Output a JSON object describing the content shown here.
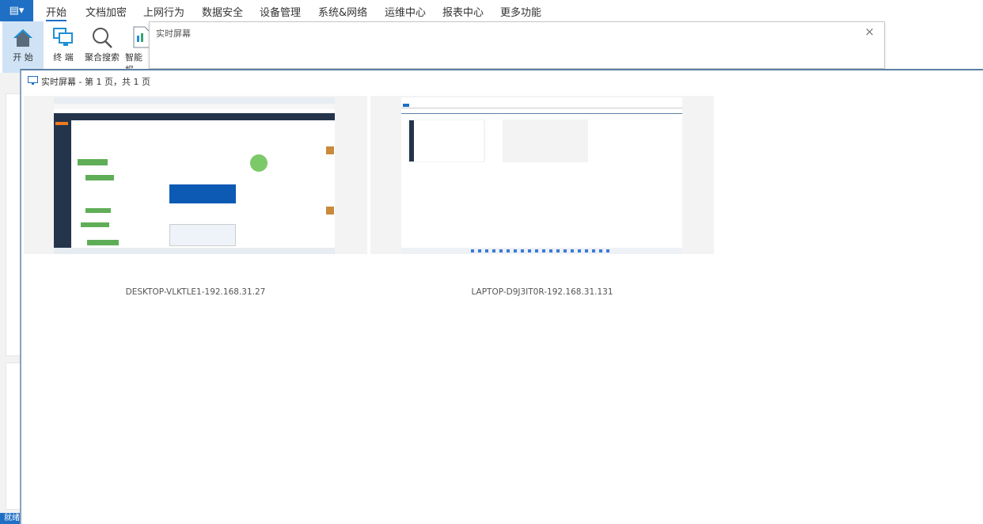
{
  "menubar": {
    "app_icon": "book-menu-icon",
    "tabs": [
      "开始",
      "文档加密",
      "上网行为",
      "数据安全",
      "设备管理",
      "系统&网络",
      "运维中心",
      "报表中心",
      "更多功能"
    ],
    "active": "开始"
  },
  "ribbon": {
    "buttons": [
      {
        "label": "开 始",
        "icon": "home-icon"
      },
      {
        "label": "终 端",
        "icon": "computers-icon"
      },
      {
        "label": "聚合搜索",
        "icon": "search-icon"
      },
      {
        "label": "智能报",
        "icon": "report-icon"
      }
    ]
  },
  "popup": {
    "title": "实时屏幕",
    "close": "×"
  },
  "window": {
    "title": "实时屏幕 - 第 1 页，共 1 页"
  },
  "screens": [
    {
      "label": "DESKTOP-VLKTLE1-192.168.31.27"
    },
    {
      "label": "LAPTOP-D9J3IT0R-192.168.31.131"
    }
  ],
  "status": {
    "text": "就绪"
  },
  "colors": {
    "accent": "#1f6fc5"
  }
}
